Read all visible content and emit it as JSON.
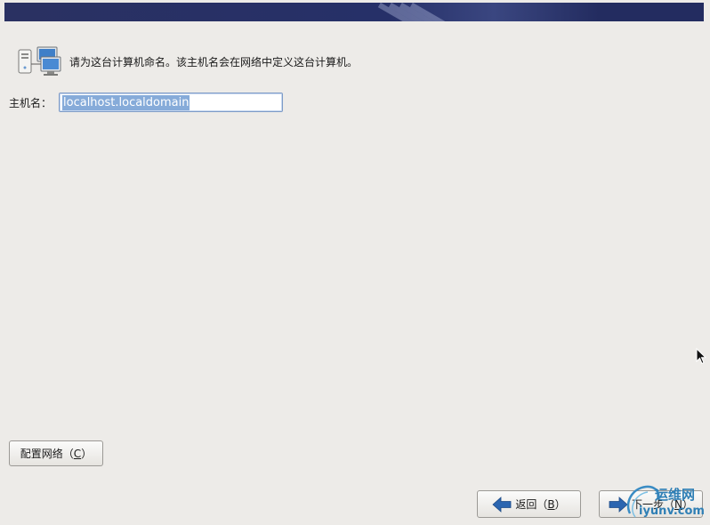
{
  "intro": {
    "text": "请为这台计算机命名。该主机名会在网络中定义这台计算机。",
    "icon": "network-computers-icon"
  },
  "hostname": {
    "label": "主机名：",
    "value": "localhost.localdomain"
  },
  "buttons": {
    "configure_network": {
      "label_prefix": "配置网络（",
      "mnemonic": "C",
      "label_suffix": "）"
    },
    "back": {
      "label_prefix": "返回（",
      "mnemonic": "B",
      "label_suffix": "）",
      "icon": "arrow-left-icon"
    },
    "next": {
      "label_prefix": "下一步（",
      "mnemonic": "N",
      "label_suffix": "）",
      "icon": "arrow-right-icon"
    }
  },
  "watermark": {
    "text": "运维网",
    "url": "iyunv.com"
  },
  "colors": {
    "background": "#edebe8",
    "banner": "#263068",
    "selection": "#86abd9",
    "arrow": "#2b65b0"
  }
}
